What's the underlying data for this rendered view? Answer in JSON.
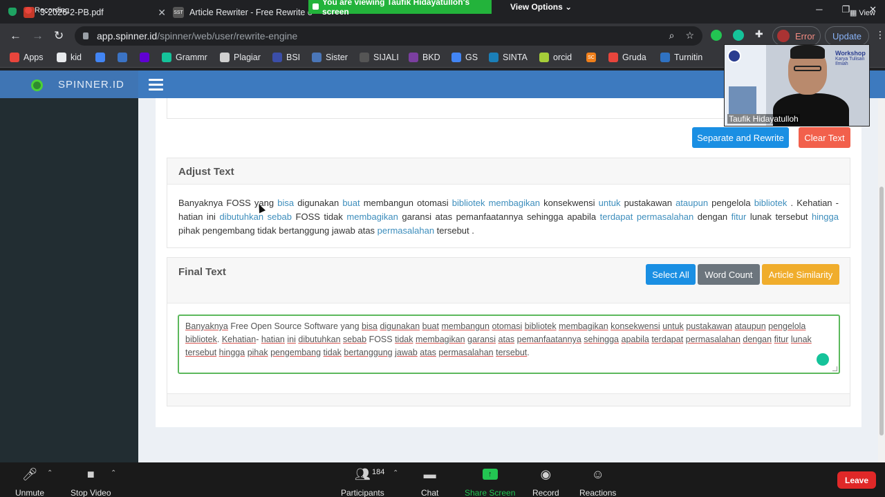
{
  "recording": {
    "label": "Recording"
  },
  "tabs": [
    {
      "title": "PB-2026-2-PB.pdf",
      "visible_title": "3-2026-2-PB.pdf"
    },
    {
      "title": "Article Rewriter - Free Rewrite o",
      "favicon_text": "SST"
    }
  ],
  "zoom_banner": {
    "text": "You are viewing Taufik Hidayatulloh's screen",
    "view_options": "View Options"
  },
  "address_bar": {
    "host": "app.spinner.id",
    "path": "/spinner/web/user/rewrite-engine"
  },
  "profile": {
    "status": "Error",
    "update_label": "Update"
  },
  "bookmarks": [
    {
      "label": "Apps",
      "color": "#e8453c"
    },
    {
      "label": "kid",
      "color": "#e8eaed"
    },
    {
      "label": "",
      "color": "#4285f4"
    },
    {
      "label": "",
      "color": "#3b73c4"
    },
    {
      "label": "",
      "color": "#6001d2"
    },
    {
      "label": "Grammr",
      "color": "#15c39a"
    },
    {
      "label": "Plagiar",
      "color": "#d0d0d0"
    },
    {
      "label": "BSI",
      "color": "#3b4ea8"
    },
    {
      "label": "Sister",
      "color": "#4a76b8"
    },
    {
      "label": "SIJALI",
      "color": "#555"
    },
    {
      "label": "BKD",
      "color": "#7b3fa0"
    },
    {
      "label": "GS",
      "color": "#4285f4"
    },
    {
      "label": "SINTA",
      "color": "#1b7fb8"
    },
    {
      "label": "orcid",
      "color": "#a6ce39"
    },
    {
      "label": "",
      "color": "#f07f1a",
      "text": "SC"
    },
    {
      "label": "Gruda",
      "color": "#e8453c"
    },
    {
      "label": "Turnitin",
      "color": "#2f72c2"
    }
  ],
  "site": {
    "brand": "SPINNER.ID"
  },
  "actions": {
    "separate_rewrite": "Separate and Rewrite",
    "clear_text": "Clear Text"
  },
  "adjust": {
    "title": "Adjust Text",
    "segments": [
      {
        "t": "Banyaknya FOSS yang ",
        "s": false
      },
      {
        "t": "bisa",
        "s": true
      },
      {
        "t": " digunakan ",
        "s": false
      },
      {
        "t": "buat",
        "s": true
      },
      {
        "t": " membangun otomasi ",
        "s": false
      },
      {
        "t": "bibliotek",
        "s": true
      },
      {
        "t": " ",
        "s": false
      },
      {
        "t": "membagikan",
        "s": true
      },
      {
        "t": " konsekwensi ",
        "s": false
      },
      {
        "t": "untuk",
        "s": true
      },
      {
        "t": " pustakawan ",
        "s": false
      },
      {
        "t": "ataupun",
        "s": true
      },
      {
        "t": " pengelola ",
        "s": false
      },
      {
        "t": "bibliotek",
        "s": true
      },
      {
        "t": " . Kehatian - hatian ini ",
        "s": false
      },
      {
        "t": "dibutuhkan",
        "s": true
      },
      {
        "t": " ",
        "s": false
      },
      {
        "t": "sebab",
        "s": true
      },
      {
        "t": " FOSS tidak ",
        "s": false
      },
      {
        "t": "membagikan",
        "s": true
      },
      {
        "t": " garansi atas pemanfaatannya sehingga apabila ",
        "s": false
      },
      {
        "t": "terdapat",
        "s": true
      },
      {
        "t": " ",
        "s": false
      },
      {
        "t": "permasalahan",
        "s": true
      },
      {
        "t": " dengan ",
        "s": false
      },
      {
        "t": "fitur",
        "s": true
      },
      {
        "t": " lunak tersebut ",
        "s": false
      },
      {
        "t": "hingga",
        "s": true
      },
      {
        "t": " pihak pengembang tidak bertanggung jawab atas ",
        "s": false
      },
      {
        "t": "permasalahan",
        "s": true
      },
      {
        "t": " tersebut .",
        "s": false
      }
    ]
  },
  "final": {
    "title": "Final Text",
    "select_all": "Select All",
    "word_count": "Word Count",
    "article_similarity": "Article Similarity",
    "segments": [
      {
        "t": "Banyaknya",
        "u": true
      },
      {
        "t": " Free Open Source Software yang ",
        "u": false
      },
      {
        "t": "bisa",
        "u": true
      },
      {
        "t": " ",
        "u": false
      },
      {
        "t": "digunakan",
        "u": true
      },
      {
        "t": " ",
        "u": false
      },
      {
        "t": "buat",
        "u": true
      },
      {
        "t": " ",
        "u": false
      },
      {
        "t": "membangun",
        "u": true
      },
      {
        "t": " ",
        "u": false
      },
      {
        "t": "otomasi",
        "u": true
      },
      {
        "t": " ",
        "u": false
      },
      {
        "t": "bibliotek",
        "u": true
      },
      {
        "t": " ",
        "u": false
      },
      {
        "t": "membagikan",
        "u": true
      },
      {
        "t": " ",
        "u": false
      },
      {
        "t": "konsekwensi",
        "u": true
      },
      {
        "t": " ",
        "u": false
      },
      {
        "t": "untuk",
        "u": true
      },
      {
        "t": " ",
        "u": false
      },
      {
        "t": "pustakawan",
        "u": true
      },
      {
        "t": " ",
        "u": false
      },
      {
        "t": "ataupun",
        "u": true
      },
      {
        "t": " ",
        "u": false
      },
      {
        "t": "pengelola",
        "u": true
      },
      {
        "t": " ",
        "u": false
      },
      {
        "t": "bibliotek",
        "u": true
      },
      {
        "t": ". ",
        "u": false
      },
      {
        "t": "Kehatian",
        "u": true
      },
      {
        "t": "- ",
        "u": false
      },
      {
        "t": "hatian",
        "u": true
      },
      {
        "t": " ",
        "u": false
      },
      {
        "t": "ini",
        "u": true
      },
      {
        "t": " ",
        "u": false
      },
      {
        "t": "dibutuhkan",
        "u": true
      },
      {
        "t": " ",
        "u": false
      },
      {
        "t": "sebab",
        "u": true
      },
      {
        "t": " FOSS ",
        "u": false
      },
      {
        "t": "tidak",
        "u": true
      },
      {
        "t": " ",
        "u": false
      },
      {
        "t": "membagikan",
        "u": true
      },
      {
        "t": " ",
        "u": false
      },
      {
        "t": "garansi",
        "u": true
      },
      {
        "t": " ",
        "u": false
      },
      {
        "t": "atas",
        "u": true
      },
      {
        "t": " ",
        "u": false
      },
      {
        "t": "pemanfaatannya",
        "u": true
      },
      {
        "t": " ",
        "u": false
      },
      {
        "t": "sehingga",
        "u": true
      },
      {
        "t": " ",
        "u": false
      },
      {
        "t": "apabila",
        "u": true
      },
      {
        "t": " ",
        "u": false
      },
      {
        "t": "terdapat",
        "u": true
      },
      {
        "t": " ",
        "u": false
      },
      {
        "t": "permasalahan",
        "u": true
      },
      {
        "t": " ",
        "u": false
      },
      {
        "t": "dengan",
        "u": true
      },
      {
        "t": " ",
        "u": false
      },
      {
        "t": "fitur",
        "u": true
      },
      {
        "t": " ",
        "u": false
      },
      {
        "t": "lunak",
        "u": true
      },
      {
        "t": " ",
        "u": false
      },
      {
        "t": "tersebut",
        "u": true
      },
      {
        "t": " ",
        "u": false
      },
      {
        "t": "hingga",
        "u": true
      },
      {
        "t": " ",
        "u": false
      },
      {
        "t": "pihak",
        "u": true
      },
      {
        "t": " ",
        "u": false
      },
      {
        "t": "pengembang",
        "u": true
      },
      {
        "t": " ",
        "u": false
      },
      {
        "t": "tidak",
        "u": true
      },
      {
        "t": " ",
        "u": false
      },
      {
        "t": "bertanggung",
        "u": true
      },
      {
        "t": " ",
        "u": false
      },
      {
        "t": "jawab",
        "u": true
      },
      {
        "t": " ",
        "u": false
      },
      {
        "t": "atas",
        "u": true
      },
      {
        "t": " ",
        "u": false
      },
      {
        "t": "permasalahan",
        "u": true
      },
      {
        "t": " ",
        "u": false
      },
      {
        "t": "tersebut",
        "u": true
      },
      {
        "t": ".",
        "u": false
      }
    ]
  },
  "speaker": {
    "name": "Taufik Hidayatulloh",
    "slide_title": "Workshop",
    "slide_subtitle": "Karya Tulisan Ilmiah"
  },
  "zoom_toolbar": {
    "unmute": "Unmute",
    "stop_video": "Stop Video",
    "participants": "Participants",
    "participant_count": "184",
    "chat": "Chat",
    "share_screen": "Share Screen",
    "record": "Record",
    "reactions": "Reactions",
    "leave": "Leave"
  },
  "top_right": {
    "view": "View"
  },
  "colors": {
    "accent": "#3c8dbc",
    "header": "#3d7abf",
    "zoom_green": "#23c552",
    "leave_red": "#e02828"
  }
}
